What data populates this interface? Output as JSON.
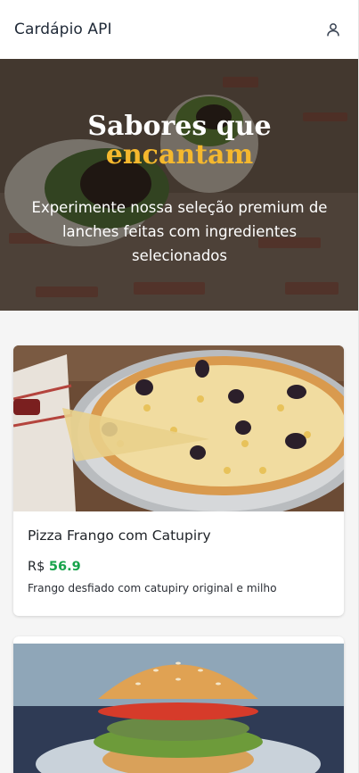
{
  "header": {
    "title": "Cardápio API",
    "user_icon": "user-icon"
  },
  "hero": {
    "title_line1": "Sabores que",
    "title_line2": "encantam",
    "subtitle": "Experimente nossa seleção premium de lanches feitas com ingredientes selecionados",
    "accent_color": "#f5b82e"
  },
  "products": [
    {
      "name": "Pizza Frango com Catupiry",
      "currency": "R$",
      "price": "56.9",
      "description": "Frango desfiado com catupiry original e milho"
    }
  ],
  "colors": {
    "price_color": "#16a34a"
  }
}
